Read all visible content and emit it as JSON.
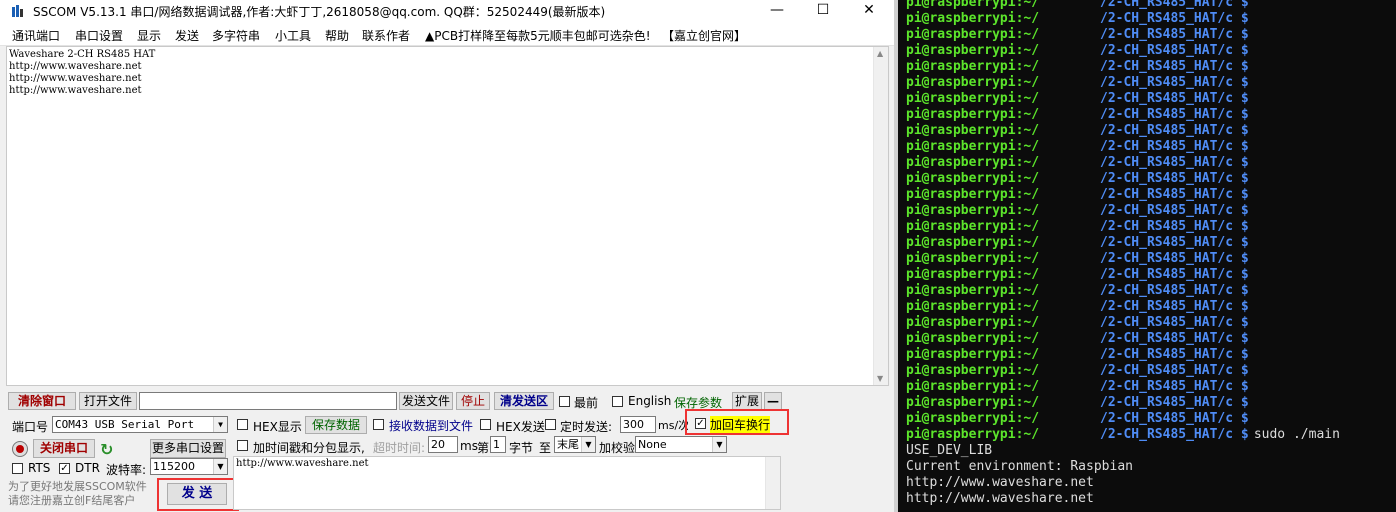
{
  "window": {
    "title": "SSCOM V5.13.1 串口/网络数据调试器,作者:大虾丁丁,2618058@qq.com. QQ群：52502449(最新版本)",
    "controls": {
      "minimize": "—",
      "maximize": "☐",
      "close": "✕"
    }
  },
  "menu": [
    "通讯端口",
    "串口设置",
    "显示",
    "发送",
    "多字符串",
    "小工具",
    "帮助",
    "联系作者",
    "▲PCB打样降至每款5元顺丰包邮可选杂色!",
    "【嘉立创官网】"
  ],
  "receive": {
    "lines": [
      "Waveshare 2-CH RS485 HAT",
      "http://www.waveshare.net",
      "http://www.waveshare.net",
      "http://www.waveshare.net"
    ]
  },
  "toolbar": {
    "clear": "清除窗口",
    "open_file": "打开文件",
    "send_file": "发送文件",
    "stop": "停止",
    "clear_send": "清发送区",
    "topmost": "最前",
    "english": "English",
    "save_params": "保存参数",
    "expand": "扩展",
    "dash": "—"
  },
  "port": {
    "label": "端口号",
    "value": "COM43 USB Serial Port",
    "close_btn": "关闭串口",
    "more_btn": "更多串口设置",
    "rts": "RTS",
    "dtr": "DTR",
    "baud_label": "波特率:",
    "baud_value": "115200"
  },
  "options": {
    "hex_display": "HEX显示",
    "save_data": "保存数据",
    "recv_to_file": "接收数据到文件",
    "hex_send": "HEX发送",
    "timed_send": "定时发送:",
    "interval": "300",
    "interval_unit": "ms/次",
    "add_crlf": "加回车换行",
    "timestamp": "加时间戳和分包显示,",
    "timeout_label": "超时时间:",
    "timeout": "20",
    "ms": "ms",
    "byte_prefix": "第",
    "byte_index": "1",
    "byte_suffix": "字节",
    "to": "至",
    "end_value": "末尾",
    "checksum_label": "加校验",
    "checksum_value": "None"
  },
  "send": {
    "text": "http://www.waveshare.net",
    "button": "发  送",
    "promo_line1": "为了更好地发展SSCOM软件",
    "promo_line2": "请您注册嘉立创F结尾客户"
  },
  "terminal": {
    "user": "pi@raspberrypi:~/",
    "path": "/2-CH_RS485_HAT/c $",
    "prompt_rows": 28,
    "command": " sudo ./main",
    "output": [
      "USE_DEV_LIB",
      "Current environment: Raspbian",
      "http://www.waveshare.net",
      "http://www.waveshare.net"
    ],
    "colors": {
      "user": "#5ce52b",
      "path": "#4f8cf5",
      "background": "#0c0c0c"
    }
  },
  "highlight_color": "#e33333"
}
